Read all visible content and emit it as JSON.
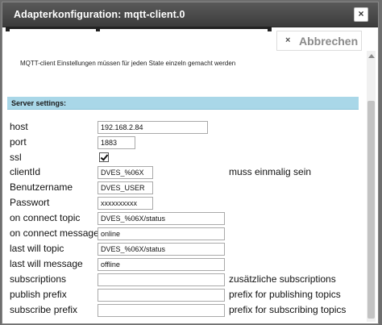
{
  "dialog": {
    "title": "Adapterkonfiguration: mqtt-client.0",
    "close_icon_glyph": "×",
    "cancel_icon_glyph": "×",
    "cancel_label": "Abbrechen"
  },
  "info_text": "MQTT-client Einstellungen müssen für jeden State einzeln gemacht werden",
  "section_title": "Server settings:",
  "fields": {
    "host": {
      "label": "host",
      "value": "192.168.2.84"
    },
    "port": {
      "label": "port",
      "value": "1883"
    },
    "ssl": {
      "label": "ssl",
      "checked": true
    },
    "clientId": {
      "label": "clientId",
      "value": "DVES_%06X",
      "hint": "muss einmalig sein"
    },
    "username": {
      "label": "Benutzername",
      "value": "DVES_USER"
    },
    "password": {
      "label": "Passwort",
      "value": "xxxxxxxxxx"
    },
    "on_connect_topic": {
      "label": "on connect topic",
      "value": "DVES_%06X/status"
    },
    "on_connect_message": {
      "label": "on connect message",
      "value": "online"
    },
    "last_will_topic": {
      "label": "last will topic",
      "value": "DVES_%06X/status"
    },
    "last_will_message": {
      "label": "last will message",
      "value": "offline"
    },
    "subscriptions": {
      "label": "subscriptions",
      "value": "",
      "hint": "zusätzliche subscriptions"
    },
    "publish_prefix": {
      "label": "publish prefix",
      "value": "",
      "hint": "prefix for publishing topics"
    },
    "subscribe_prefix": {
      "label": "subscribe prefix",
      "value": "",
      "hint": "prefix for subscribing topics"
    }
  }
}
